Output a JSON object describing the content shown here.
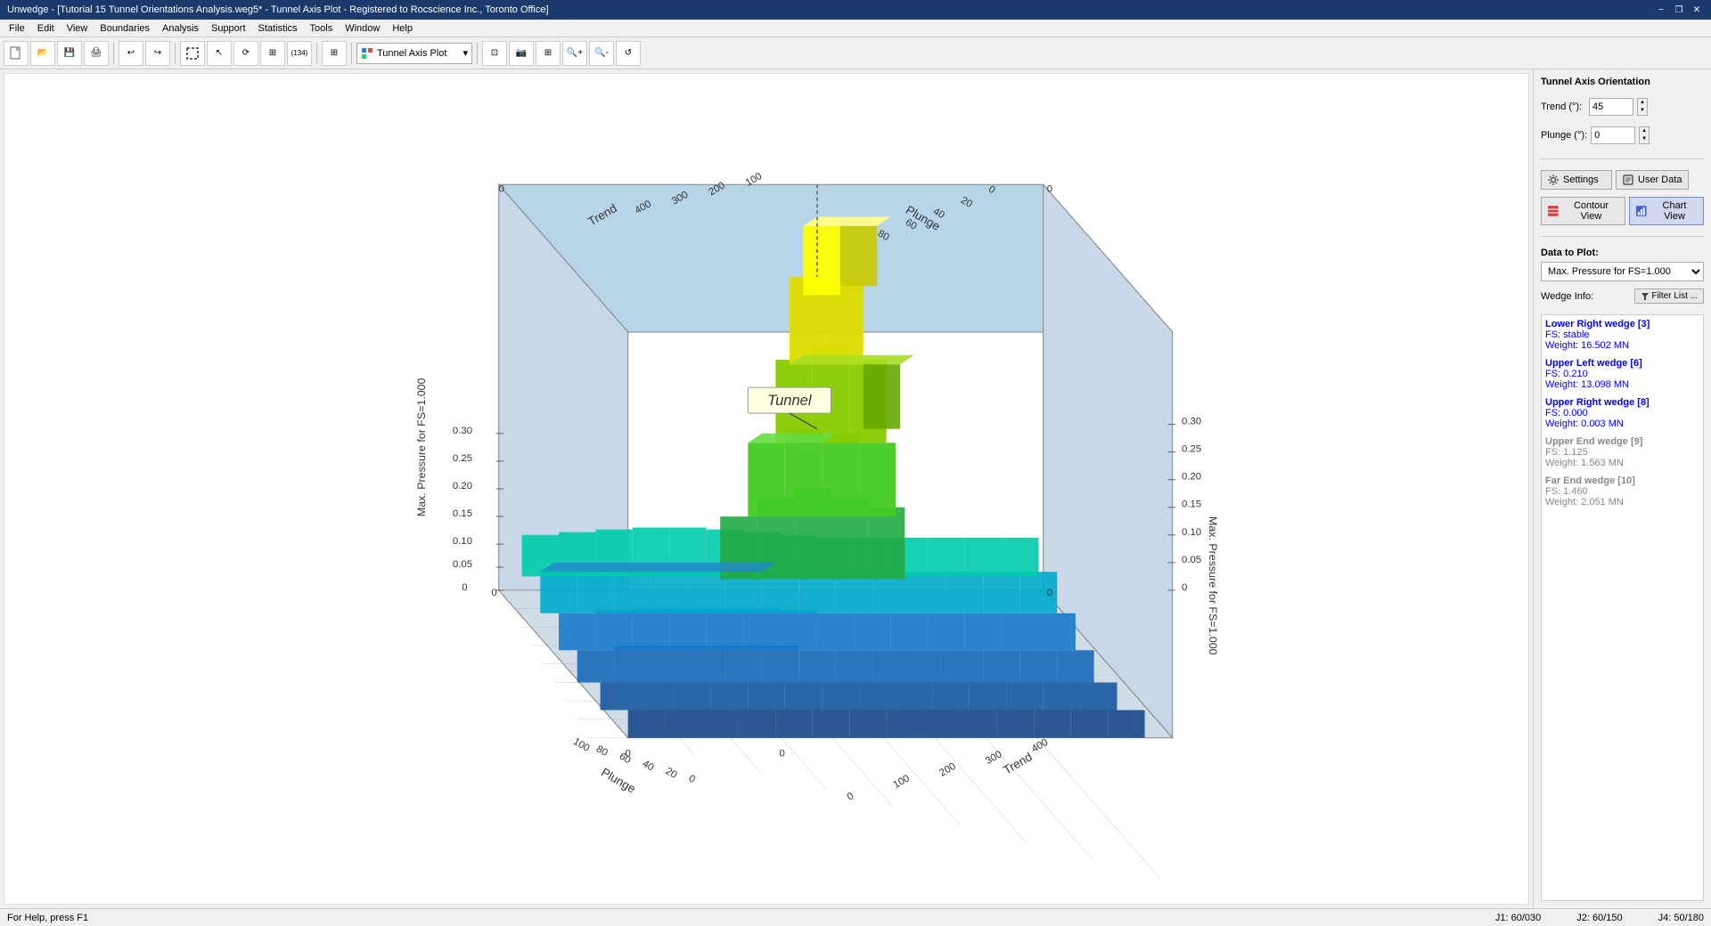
{
  "titlebar": {
    "title": "Unwedge - [Tutorial 15 Tunnel Orientations Analysis.weg5* - Tunnel Axis Plot - Registered to Rocscience Inc., Toronto Office]",
    "minimize": "−",
    "restore": "❐",
    "close": "✕",
    "inner_minimize": "−",
    "inner_restore": "❐",
    "inner_close": "✕"
  },
  "menu": {
    "items": [
      "File",
      "Edit",
      "View",
      "Boundaries",
      "Analysis",
      "Support",
      "Statistics",
      "Tools",
      "Window",
      "Help"
    ]
  },
  "toolbar": {
    "dropdown_label": "Tunnel Axis Plot"
  },
  "right_panel": {
    "section_title": "Tunnel Axis Orientation",
    "trend_label": "Trend (°):",
    "trend_value": "45",
    "plunge_label": "Plunge (°):",
    "plunge_value": "0",
    "settings_label": "Settings",
    "user_data_label": "User Data",
    "contour_view_label": "Contour View",
    "chart_view_label": "Chart View",
    "data_to_plot_label": "Data to Plot:",
    "data_dropdown_value": "Max. Pressure for FS=1.000",
    "wedge_info_label": "Wedge Info:",
    "filter_btn_label": "Filter List ...",
    "wedges": [
      {
        "name": "Lower Right wedge [3]",
        "fs": "FS:  stable",
        "weight": "Weight:  16.502 MN",
        "state": "active"
      },
      {
        "name": "Upper Left wedge [6]",
        "fs": "FS:  0.210",
        "weight": "Weight:  13.098 MN",
        "state": "active"
      },
      {
        "name": "Upper Right wedge [8]",
        "fs": "FS:  0.000",
        "weight": "Weight:  0.003 MN",
        "state": "active"
      },
      {
        "name": "Upper End wedge [9]",
        "fs": "FS:  1.125",
        "weight": "Weight:  1.563 MN",
        "state": "inactive"
      },
      {
        "name": "Far End wedge [10]",
        "fs": "FS:  1.460",
        "weight": "Weight:  2.051 MN",
        "state": "inactive"
      }
    ]
  },
  "status_bar": {
    "help_text": "For Help, press F1",
    "j1": "J1: 60/030",
    "j2": "J2: 60/150",
    "j4": "J4: 50/180"
  },
  "chart": {
    "title": "Tunnel",
    "x_axis": "Trend",
    "y_axis": "Plunge",
    "z_axis": "Max. Pressure for FS=1.000",
    "x_ticks": [
      "0",
      "100",
      "200",
      "300",
      "400"
    ],
    "y_ticks": [
      "0",
      "20",
      "40",
      "60",
      "80",
      "100"
    ],
    "z_ticks": [
      "0",
      "0.05",
      "0.10",
      "0.15",
      "0.20",
      "0.25",
      "0.30"
    ]
  }
}
